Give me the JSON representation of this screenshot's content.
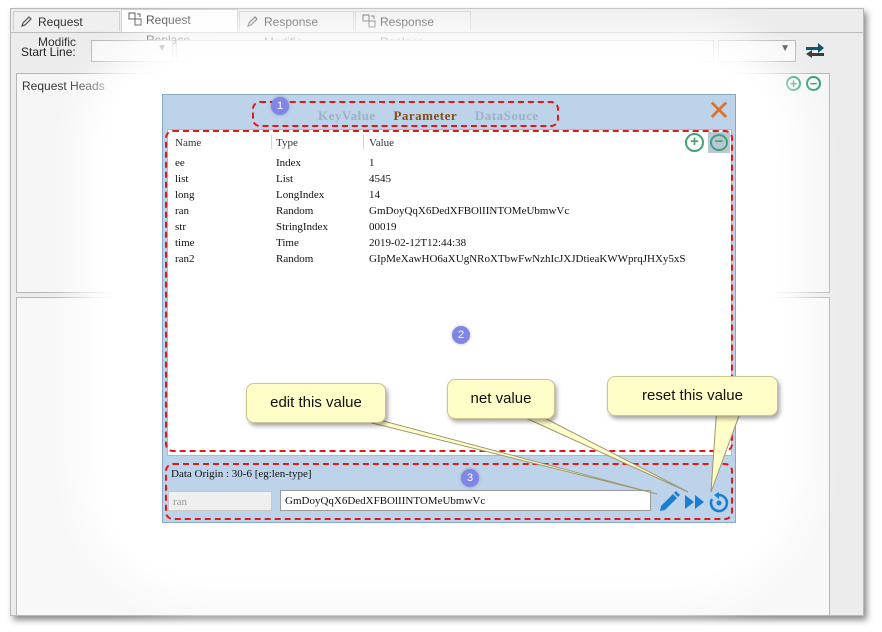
{
  "tabs": [
    {
      "label": "Request Modific",
      "icon": "pencil-icon",
      "active": false
    },
    {
      "label": "Request Replace",
      "icon": "replace-icon",
      "active": true
    },
    {
      "label": "Response Modific",
      "icon": "pencil-icon",
      "active": false
    },
    {
      "label": "Response Replace",
      "icon": "replace-icon",
      "active": false
    }
  ],
  "toolbar": {
    "start_line_label": "Start Line:",
    "start_line_value": "",
    "line_text": "",
    "mode_value": ""
  },
  "request_heads": {
    "title": "Request Heads"
  },
  "dialog": {
    "tabs": [
      "KeyValue",
      "Parameter",
      "DataSouce"
    ],
    "active_tab": "Parameter",
    "close_icon": "close-icon",
    "columns": [
      "Name",
      "Type",
      "Value"
    ],
    "rows": [
      {
        "name": "ee",
        "type": "Index",
        "value": "1"
      },
      {
        "name": "list",
        "type": "List",
        "value": "4545"
      },
      {
        "name": "long",
        "type": "LongIndex",
        "value": "14"
      },
      {
        "name": "ran",
        "type": "Random",
        "value": "GmDoyQqX6DedXFBOlIINTOMeUbmwVc"
      },
      {
        "name": "str",
        "type": "StringIndex",
        "value": "00019"
      },
      {
        "name": "time",
        "type": "Time",
        "value": "2019-02-12T12:44:38"
      },
      {
        "name": "ran2",
        "type": "Random",
        "value": "GIpMeXawHO6aXUgNRoXTbwFwNzhIcJXJDtieaKWWprqJHXy5xS"
      }
    ],
    "data_origin": "Data Origin : 30-6 [eg:len-type]",
    "edit_name": "ran",
    "edit_value": "GmDoyQqX6DedXFBOlIINTOMeUbmwVc"
  },
  "badges": [
    "1",
    "2",
    "3"
  ],
  "callouts": {
    "edit": "edit this value",
    "next": "net value",
    "reset": "reset this value"
  },
  "colors": {
    "annotation_red": "#e01818",
    "badge": "#7f86e8",
    "dialog_bg": "#bcd3ea",
    "accent_green": "#2c9a6a",
    "icon_blue": "#1a7fd1",
    "close_orange": "#e0702c"
  }
}
